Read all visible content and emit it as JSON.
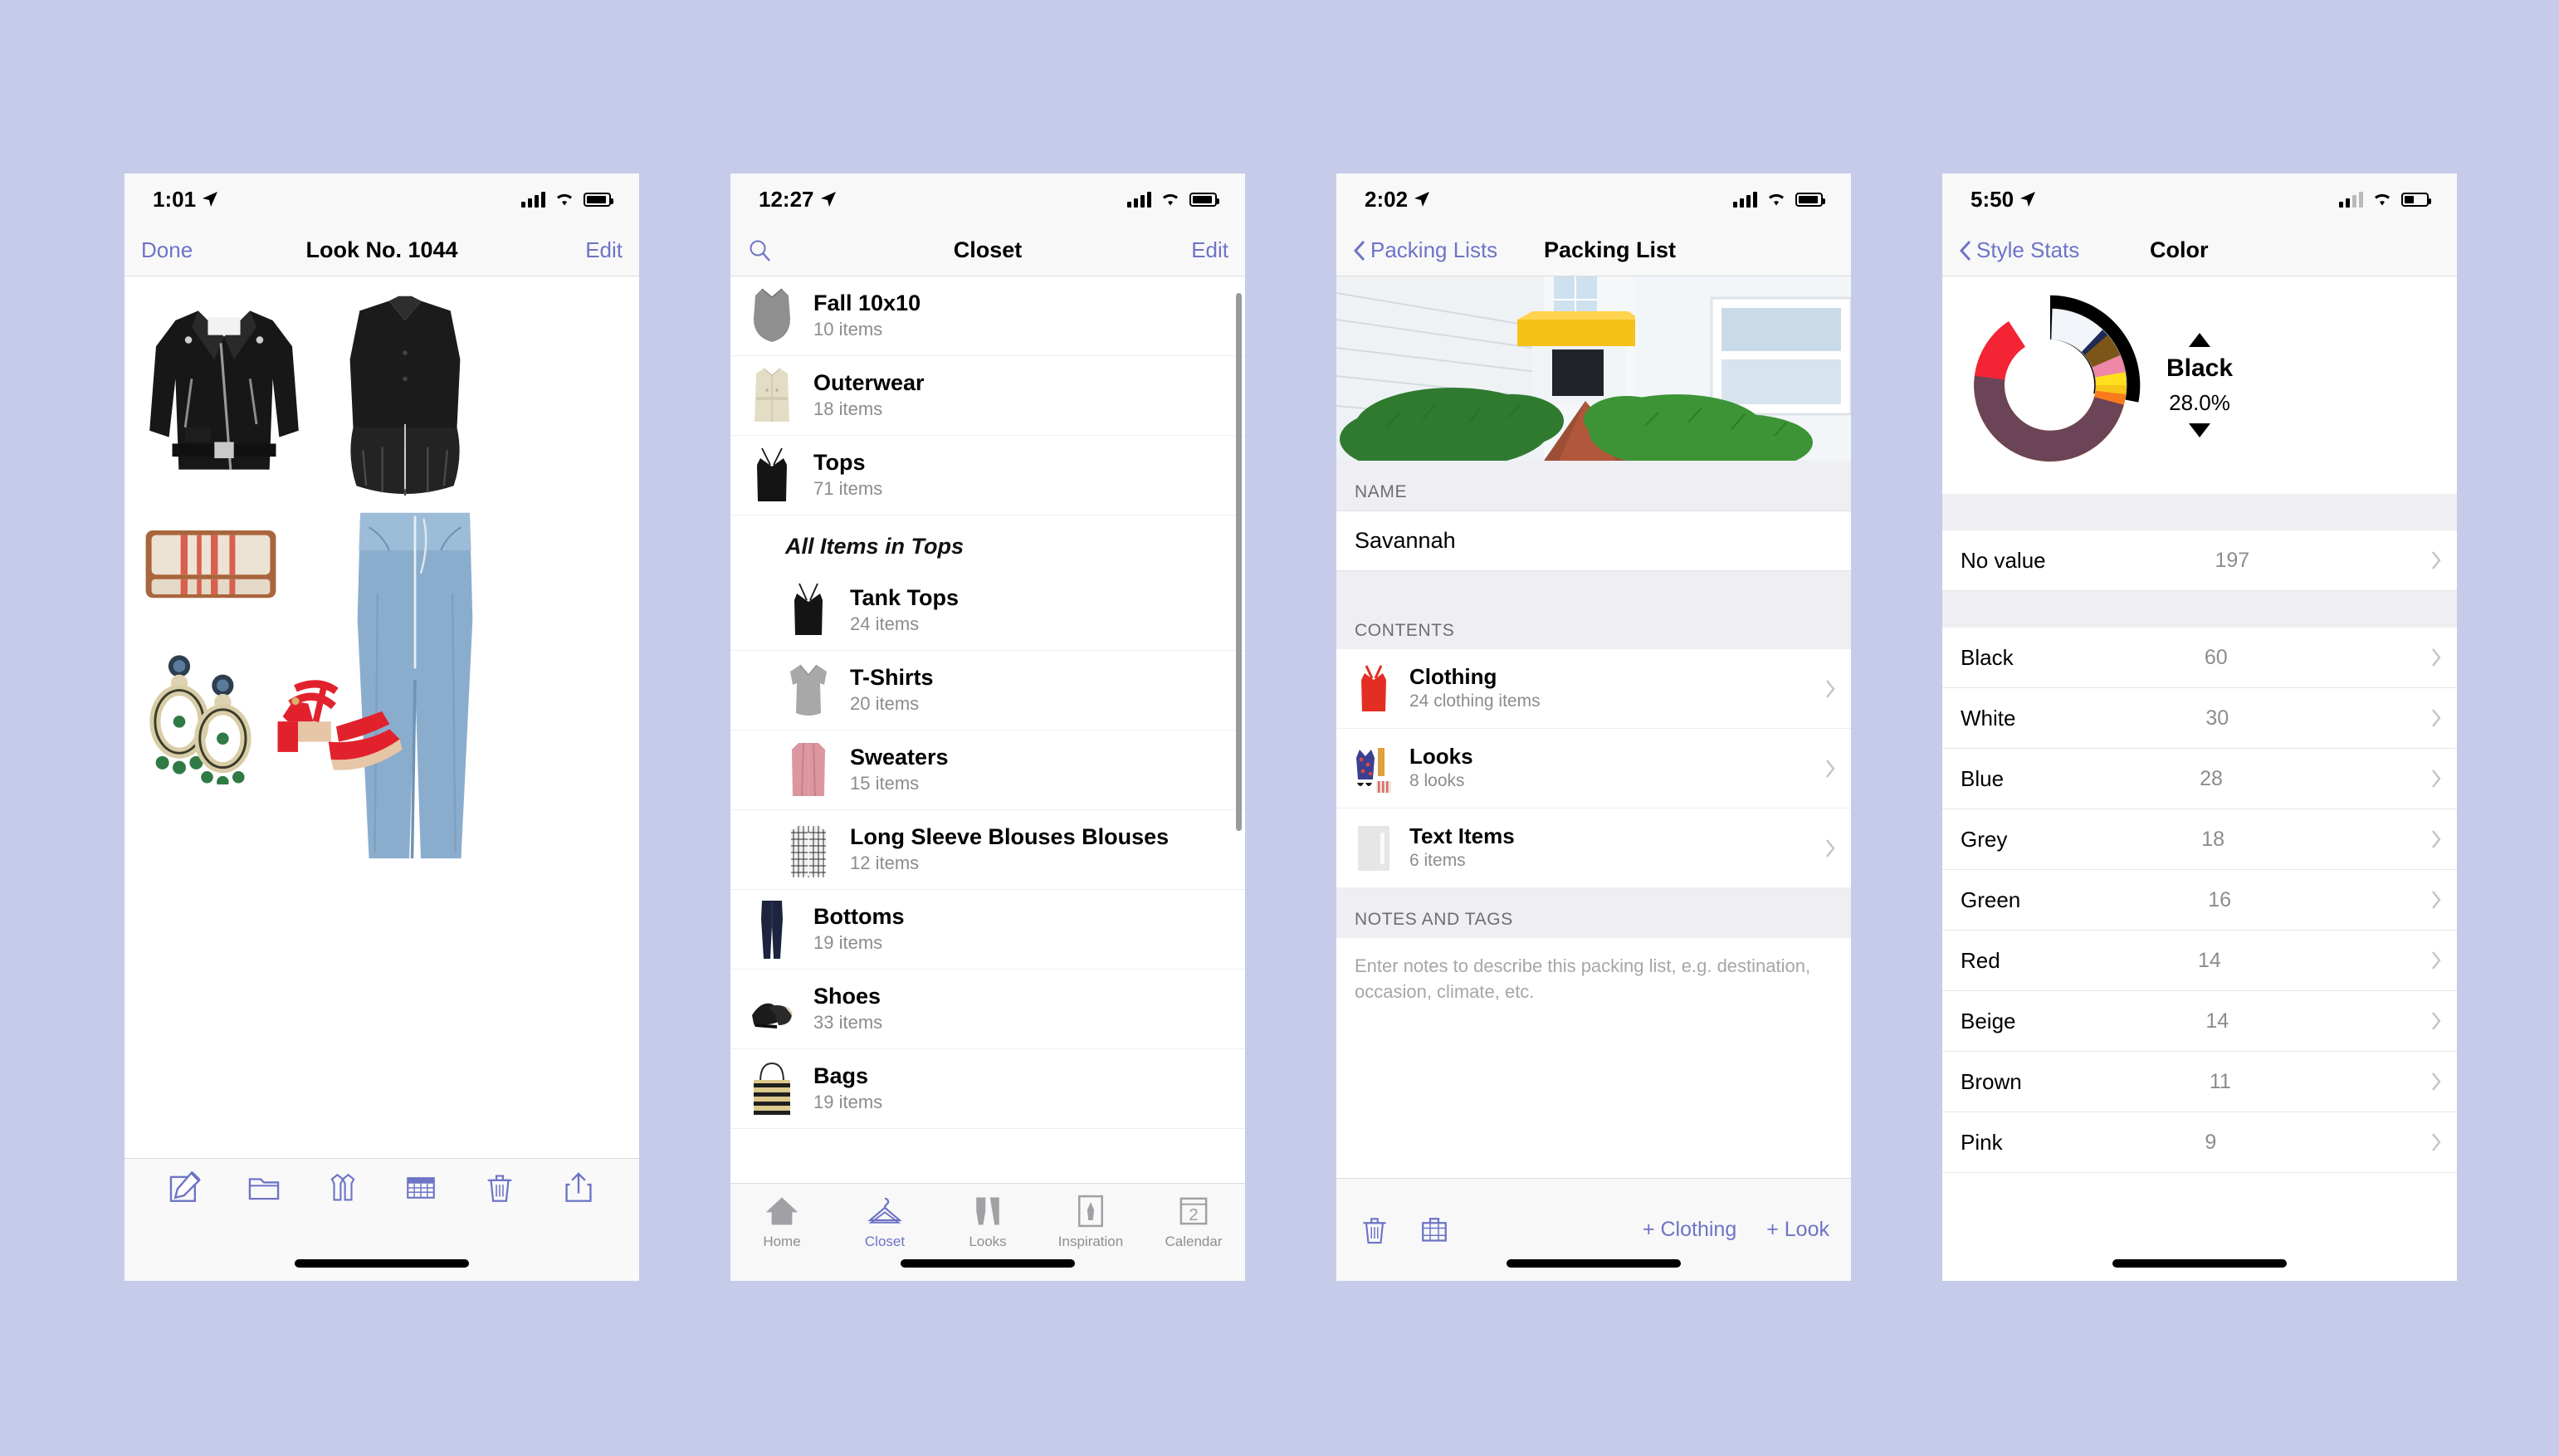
{
  "screen1": {
    "status": {
      "time": "1:01"
    },
    "nav": {
      "left": "Done",
      "title": "Look No. 1044",
      "right": "Edit"
    },
    "collage": {
      "items": [
        "black-leather-biker-jacket",
        "black-sleeveless-peplum-blouse",
        "red-striped-canvas-clutch",
        "light-wash-wide-leg-jeans",
        "beaded-chandelier-earrings",
        "red-suede-block-heel-sandals"
      ]
    },
    "toolbar": [
      {
        "icon": "edit-icon",
        "name": "edit-button"
      },
      {
        "icon": "folder-icon",
        "name": "folder-button"
      },
      {
        "icon": "outfit-icon",
        "name": "outfit-button"
      },
      {
        "icon": "calendar-icon",
        "name": "calendar-button"
      },
      {
        "icon": "trash-icon",
        "name": "delete-button"
      },
      {
        "icon": "share-icon",
        "name": "share-button"
      }
    ]
  },
  "screen2": {
    "status": {
      "time": "12:27"
    },
    "nav": {
      "search_icon": "search-icon",
      "title": "Closet",
      "right": "Edit"
    },
    "categories": [
      {
        "label": "Fall 10x10",
        "count": "10 items",
        "thumb": "grey-tank-dress"
      },
      {
        "label": "Outerwear",
        "count": "18 items",
        "thumb": "beige-trench-coat"
      },
      {
        "label": "Tops",
        "count": "71 items",
        "thumb": "black-camisole"
      }
    ],
    "section_header": "All Items in Tops",
    "subitems": [
      {
        "label": "Tank Tops",
        "count": "24 items",
        "thumb": "black-tank-top"
      },
      {
        "label": "T-Shirts",
        "count": "20 items",
        "thumb": "grey-tshirt"
      },
      {
        "label": "Sweaters",
        "count": "15 items",
        "thumb": "pink-cardigan"
      },
      {
        "label": "Long Sleeve Blouses Blouses",
        "count": "12 items",
        "thumb": "checked-blouse"
      }
    ],
    "categories2": [
      {
        "label": "Bottoms",
        "count": "19 items",
        "thumb": "navy-trousers"
      },
      {
        "label": "Shoes",
        "count": "33 items",
        "thumb": "black-loafers"
      },
      {
        "label": "Bags",
        "count": "19 items",
        "thumb": "striped-straw-tote"
      }
    ],
    "tabs": [
      {
        "label": "Home",
        "icon": "home-icon",
        "active": false
      },
      {
        "label": "Closet",
        "icon": "hanger-icon",
        "active": true
      },
      {
        "label": "Looks",
        "icon": "looks-icon",
        "active": false
      },
      {
        "label": "Inspiration",
        "icon": "inspiration-icon",
        "active": false
      },
      {
        "label": "Calendar",
        "icon": "calendar-icon",
        "active": false,
        "badge": "2"
      }
    ]
  },
  "screen3": {
    "status": {
      "time": "2:02"
    },
    "nav": {
      "back": "Packing Lists",
      "title": "Packing List"
    },
    "photo_alt": "courtyard-walkway-photo",
    "name_header": "NAME",
    "name_value": "Savannah",
    "contents_header": "CONTENTS",
    "contents": [
      {
        "label": "Clothing",
        "sub": "24 clothing items",
        "thumb": "red-tank-top"
      },
      {
        "label": "Looks",
        "sub": "8 looks",
        "thumb": "floral-dress-look"
      },
      {
        "label": "Text Items",
        "sub": "6 items",
        "thumb": "blank-placeholder"
      }
    ],
    "notes_header": "NOTES AND TAGS",
    "notes_placeholder": "Enter notes to describe this packing list, e.g. destination, occasion, climate, etc.",
    "toolbar": {
      "trash_icon": "trash-icon",
      "suitcase_icon": "suitcase-icon",
      "add_clothing": "+ Clothing",
      "add_look": "+ Look"
    }
  },
  "screen4": {
    "status": {
      "time": "5:50"
    },
    "nav": {
      "back": "Style Stats",
      "title": "Color"
    },
    "selected": {
      "name": "Black",
      "percent": "28.0%"
    },
    "no_value_row": {
      "label": "No value",
      "value": "197"
    },
    "rows": [
      {
        "label": "Black",
        "value": "60"
      },
      {
        "label": "White",
        "value": "30"
      },
      {
        "label": "Blue",
        "value": "28"
      },
      {
        "label": "Grey",
        "value": "18"
      },
      {
        "label": "Green",
        "value": "16"
      },
      {
        "label": "Red",
        "value": "14"
      },
      {
        "label": "Beige",
        "value": "14"
      },
      {
        "label": "Brown",
        "value": "11"
      },
      {
        "label": "Pink",
        "value": "9"
      }
    ],
    "chart_data": {
      "type": "pie",
      "title": "Color",
      "labels": [
        "Black",
        "White",
        "Blue",
        "Grey",
        "Green",
        "Beige",
        "Red",
        "Brown",
        "Pink",
        "Yellow",
        "Gold",
        "Orange",
        "Purple"
      ],
      "values": [
        60,
        30,
        28,
        18,
        16,
        14,
        14,
        11,
        9,
        5,
        4,
        3,
        3
      ],
      "colors": [
        "#000000",
        "#f2f6fa",
        "#1f2a57",
        "#b4b4b4",
        "#5d8040",
        "#deba8e",
        "#f42434",
        "#7c5518",
        "#ef87a6",
        "#ffe01f",
        "#f5c518",
        "#fa7a1e",
        "#6b4457"
      ],
      "selected_label": "Black",
      "selected_percent": 28.0,
      "legend": "right",
      "exploded": [
        "Black"
      ]
    }
  },
  "theme": {
    "accent": "#6d74c6",
    "background": "#c5cbe8",
    "panel": "#f8f8f8"
  }
}
